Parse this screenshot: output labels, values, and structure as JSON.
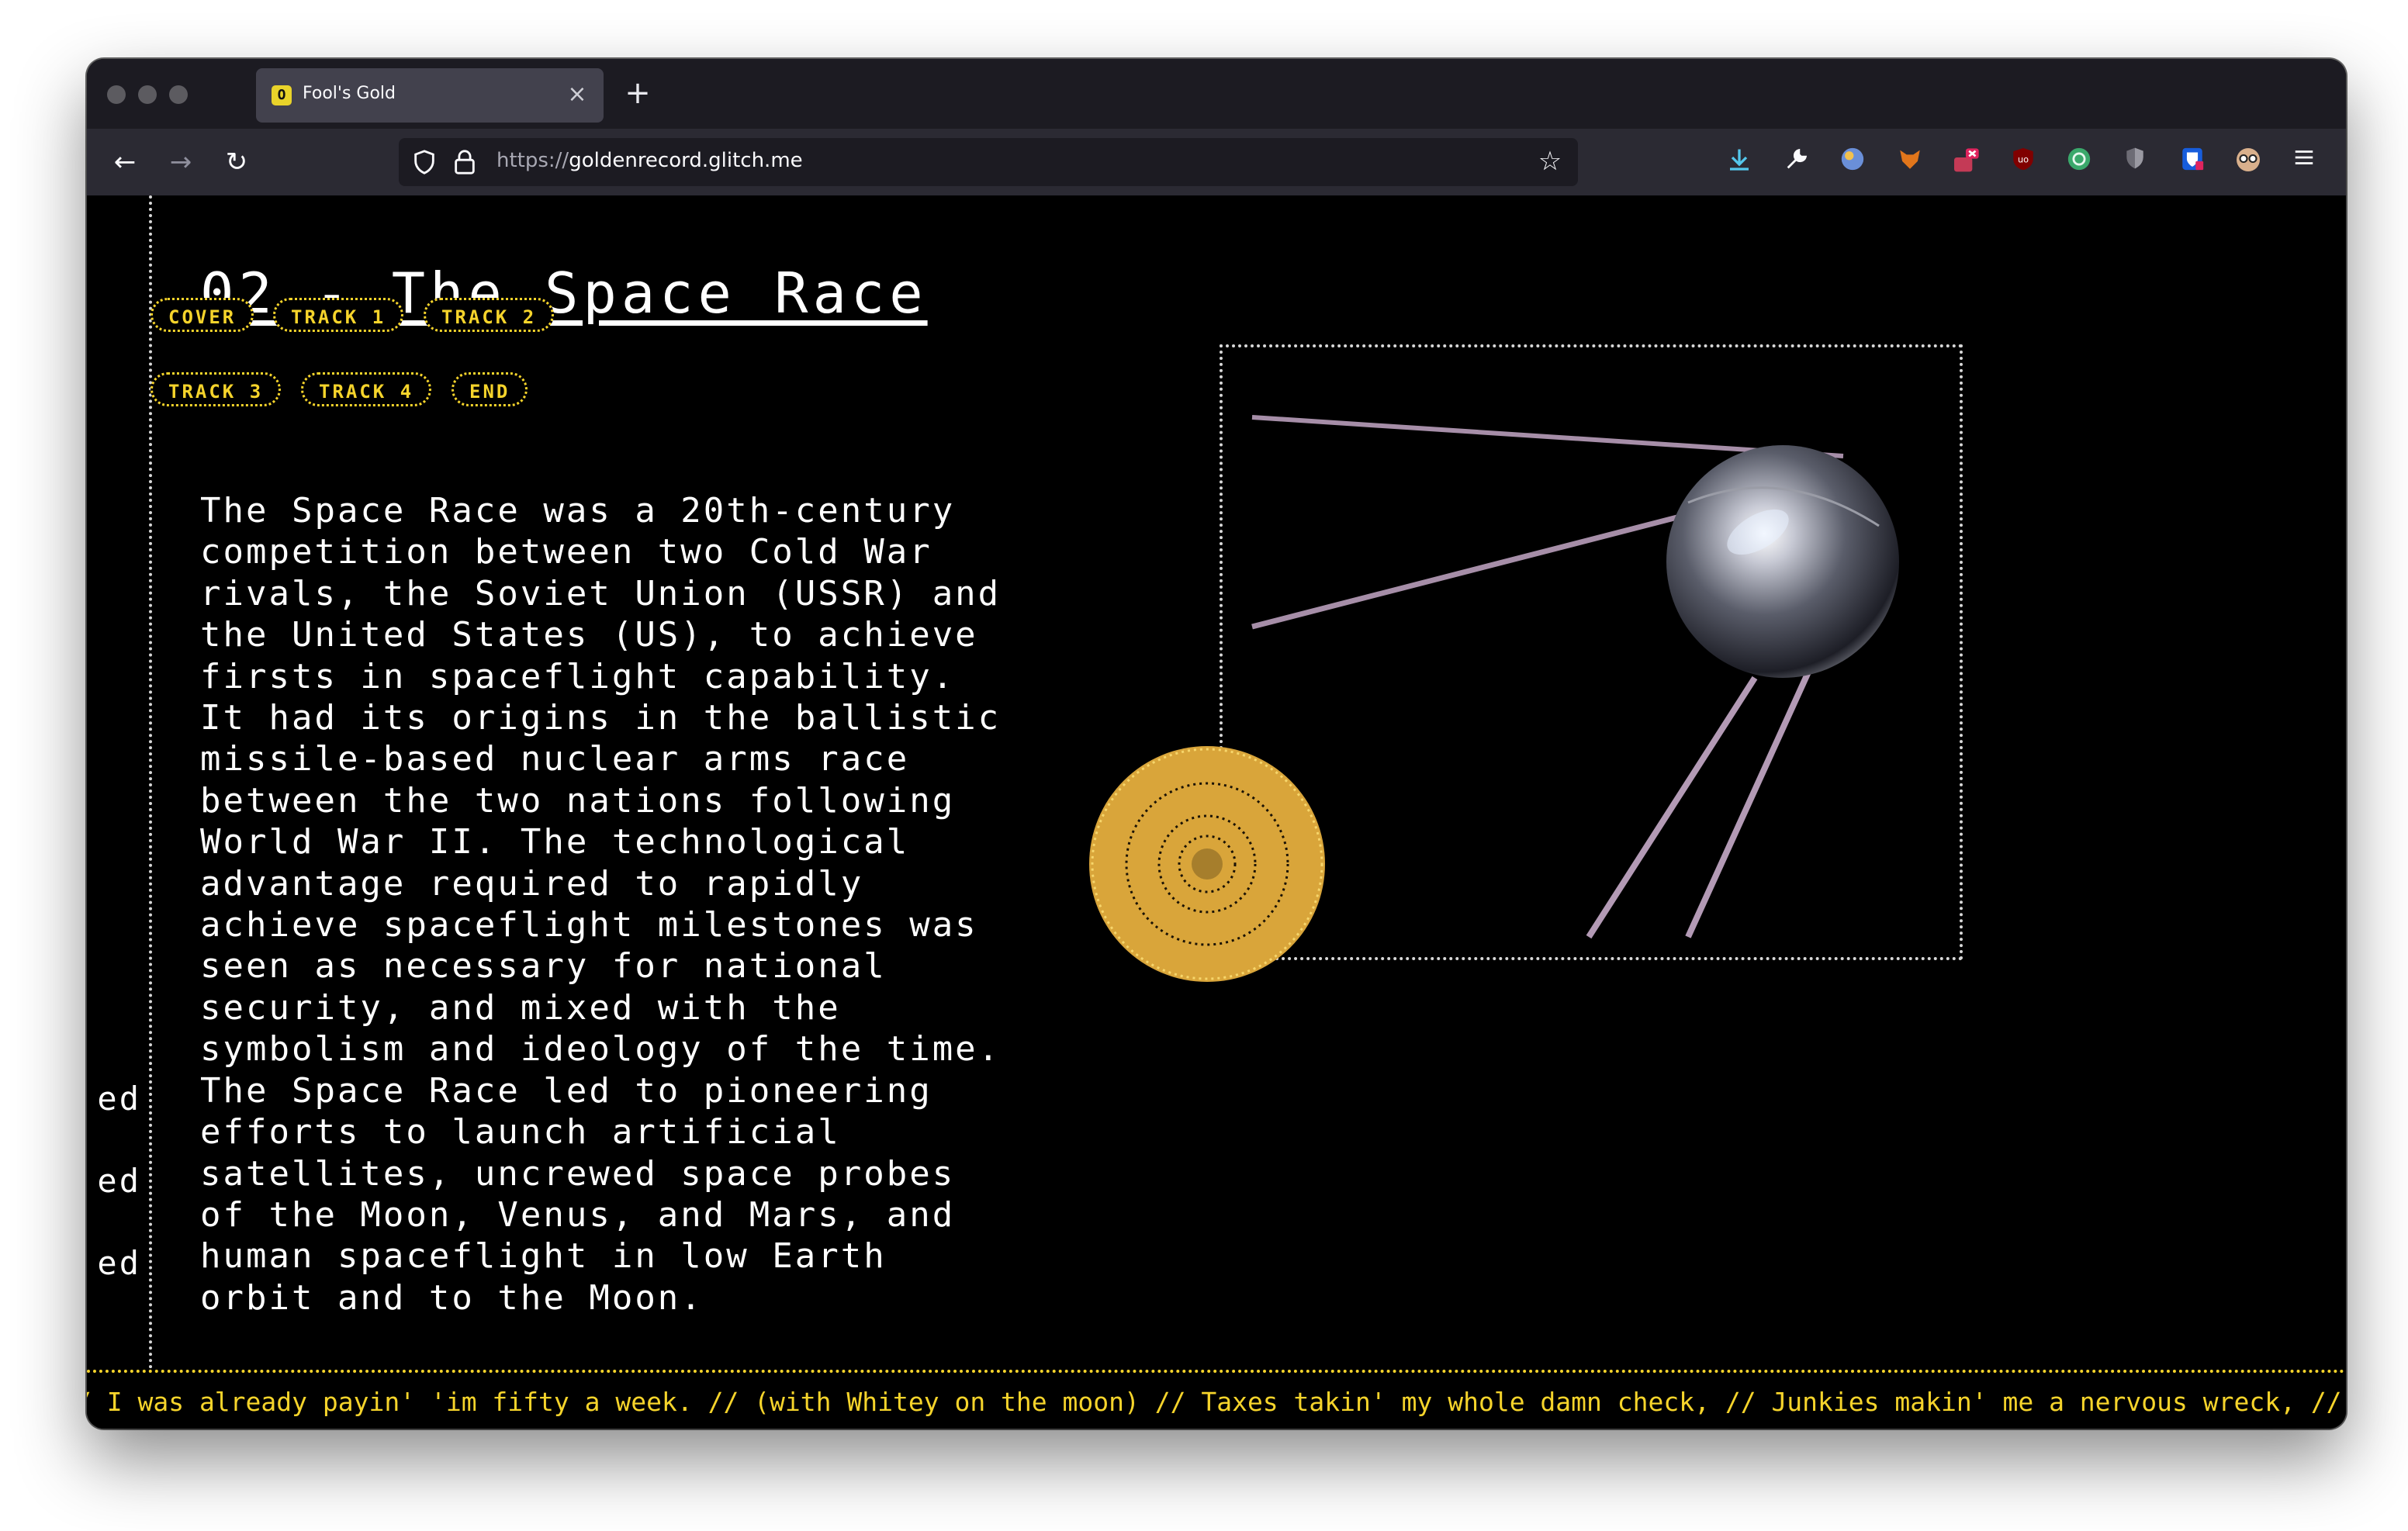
{
  "browser": {
    "tab": {
      "favicon": "O",
      "title": "Fool's Gold",
      "close": "×"
    },
    "new_tab": "+",
    "nav": {
      "back": "←",
      "forward": "→",
      "reload": "↻"
    },
    "url": {
      "scheme": "https://",
      "host": "goldenrecord.glitch.me"
    },
    "bookmark_icon": "☆",
    "extensions": [
      "download-icon",
      "wrench-icon",
      "globe-icon",
      "fox-icon",
      "extension-badge-icon",
      "ublock-icon",
      "sync-icon",
      "shield-icon",
      "bitwarden-icon",
      "glasses-icon",
      "menu-icon"
    ]
  },
  "page": {
    "nav_pills": [
      {
        "label": "COVER"
      },
      {
        "label": "TRACK 1"
      },
      {
        "label": "TRACK 2"
      },
      {
        "label": "TRACK 3"
      },
      {
        "label": "TRACK 4"
      },
      {
        "label": "END"
      }
    ],
    "heading": "02 - The Space Race",
    "body": "The Space Race was a 20th-century\ncompetition between two Cold War\nrivals, the Soviet Union (USSR) and\nthe United States (US), to achieve\nfirsts in spaceflight capability.\nIt had its origins in the ballistic\nmissile-based nuclear arms race\nbetween the two nations following\nWorld War II. The technological\nadvantage required to rapidly\nachieve spaceflight milestones was\nseen as necessary for national\nsecurity, and mixed with the\nsymbolism and ideology of the time.\nThe Space Race led to pioneering\nefforts to launch artificial\nsatellites, uncrewed space probes\nof the Moon, Venus, and Mars, and\nhuman spaceflight in low Earth\norbit and to the Moon.",
    "side_fragments": [
      "ed",
      "ed",
      "ed"
    ],
    "ticker": "/ I was already payin' 'im fifty a week. // (with Whitey on the moon) // Taxes takin' my whole damn check, // Junkies makin' me a nervous wreck, // T",
    "colors": {
      "accent": "#f6d42b",
      "record_gold": "#d9a53a",
      "background": "#000000"
    }
  }
}
